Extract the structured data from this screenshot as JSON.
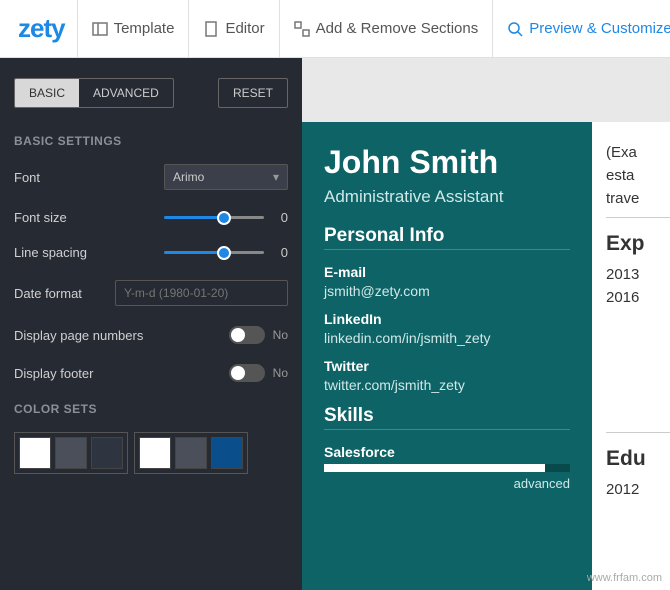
{
  "brand": "zety",
  "topnav": {
    "template": "Template",
    "editor": "Editor",
    "add_remove": "Add & Remove Sections",
    "preview": "Preview & Customize",
    "share": ""
  },
  "sidebar": {
    "tab_basic": "BASIC",
    "tab_advanced": "ADVANCED",
    "reset": "RESET",
    "section_basic": "BASIC SETTINGS",
    "font_label": "Font",
    "font_value": "Arimo",
    "fontsize_label": "Font size",
    "fontsize_value": "0",
    "linespacing_label": "Line spacing",
    "linespacing_value": "0",
    "dateformat_label": "Date format",
    "dateformat_placeholder": "Y-m-d (1980-01-20)",
    "pagenumbers_label": "Display page numbers",
    "pagenumbers_state": "No",
    "footer_label": "Display footer",
    "footer_state": "No",
    "section_colors": "COLOR SETS",
    "color_sets": [
      [
        "#ffffff",
        "#4a4f5a",
        "#2e3440"
      ],
      [
        "#ffffff",
        "#4a4f5a",
        "#0b4e8c"
      ]
    ]
  },
  "resume": {
    "name": "John Smith",
    "title": "Administrative Assistant",
    "section_personal": "Personal Info",
    "email_label": "E-mail",
    "email": "jsmith@zety.com",
    "linkedin_label": "LinkedIn",
    "linkedin": "linkedin.com/in/jsmith_zety",
    "twitter_label": "Twitter",
    "twitter": "twitter.com/jsmith_zety",
    "section_skills": "Skills",
    "skill_name": "Salesforce",
    "skill_level": "advanced",
    "right_blurb1": "(Exa",
    "right_blurb2": "esta",
    "right_blurb3": "trave",
    "right_exp": "Exp",
    "right_y1": "2013",
    "right_y2": "2016",
    "right_edu": "Edu",
    "right_y3": "2012"
  },
  "watermark": "www.frfam.com"
}
